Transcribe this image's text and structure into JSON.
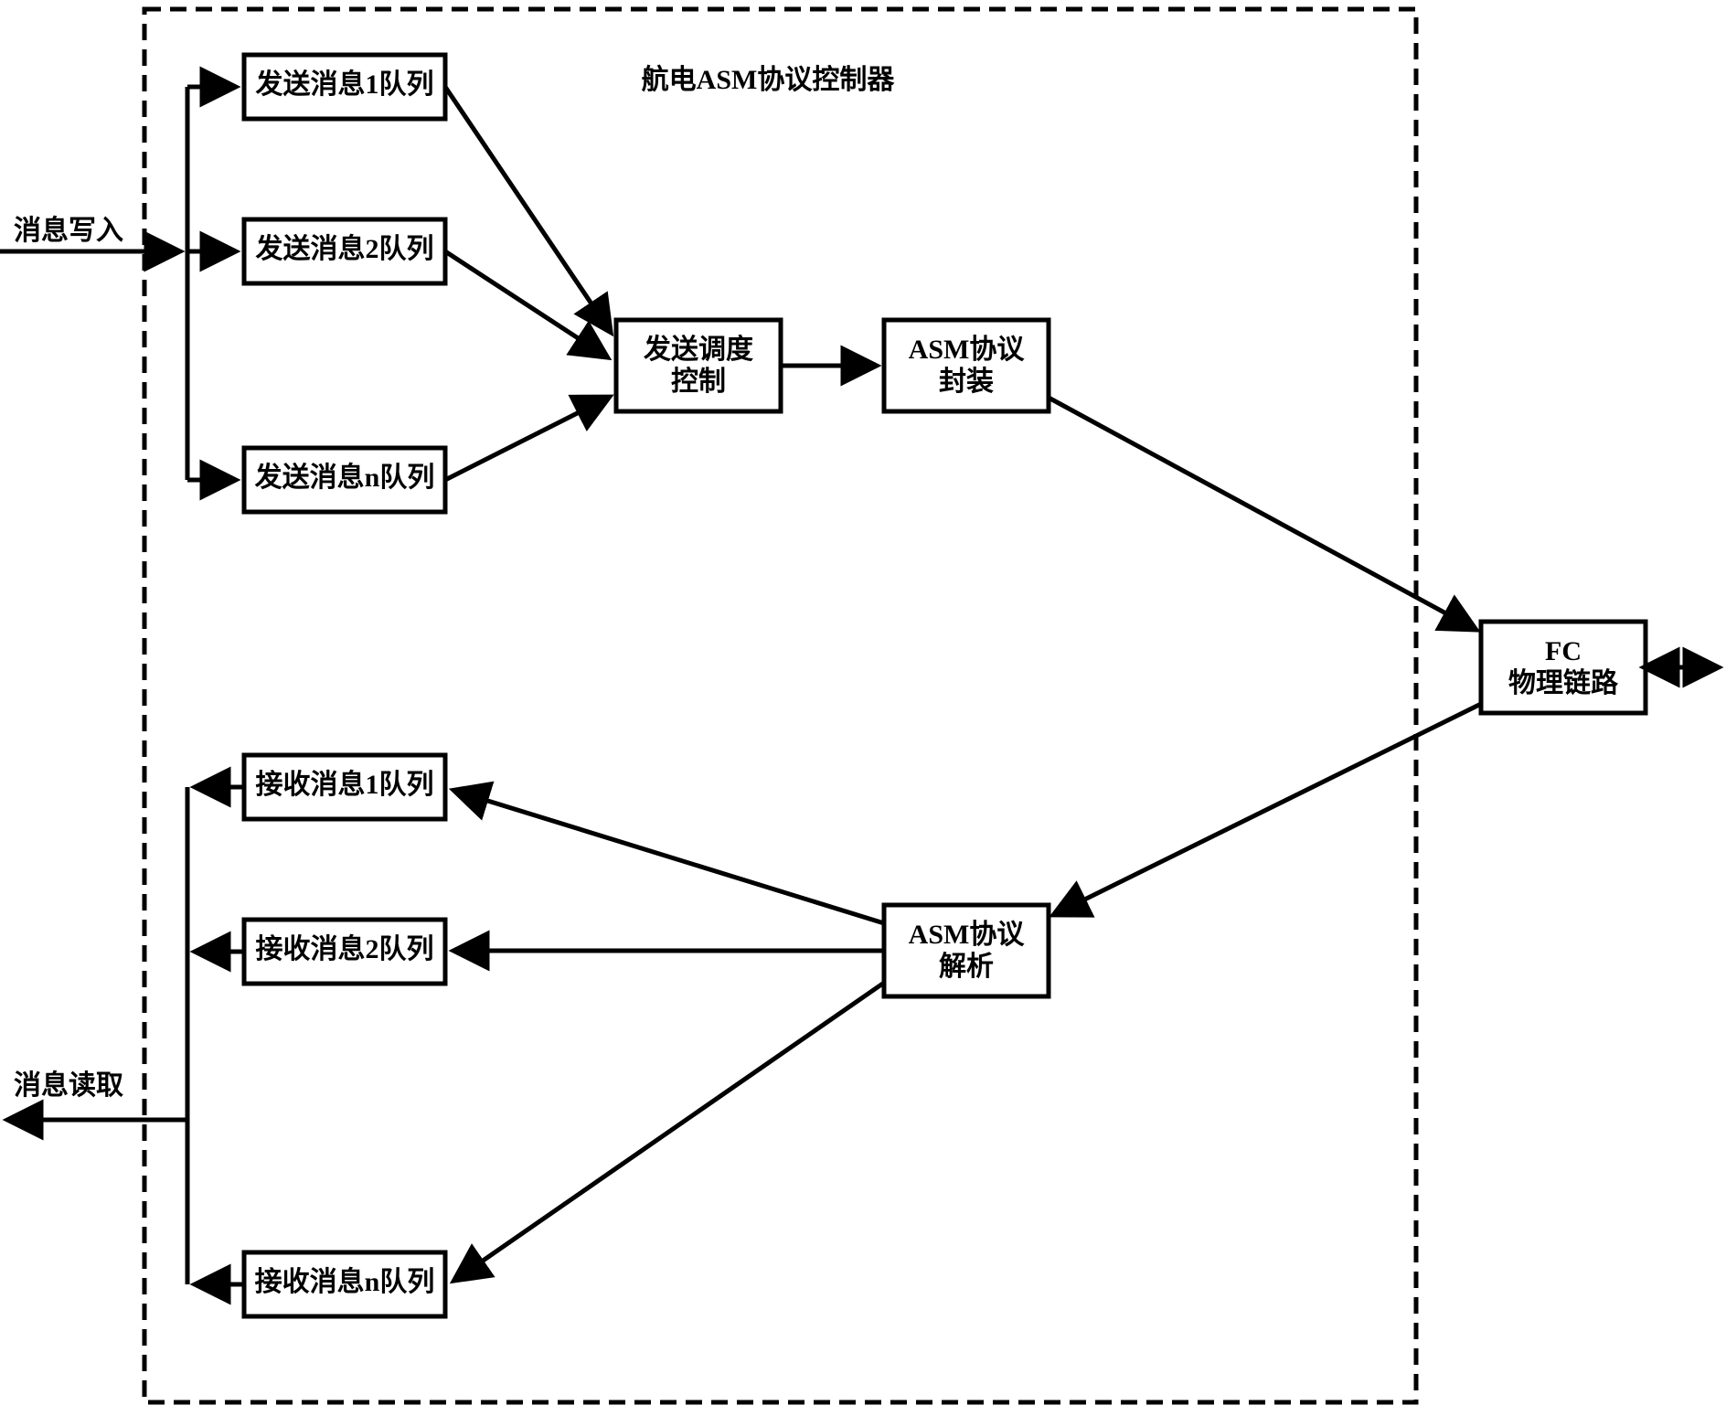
{
  "container_title": "航电ASM协议控制器",
  "external": {
    "msg_write": "消息写入",
    "msg_read": "消息读取"
  },
  "send": {
    "q1": "发送消息1队列",
    "q2": "发送消息2队列",
    "qn": "发送消息n队列",
    "sched_l1": "发送调度",
    "sched_l2": "控制",
    "encap_l1": "ASM协议",
    "encap_l2": "封装"
  },
  "recv": {
    "q1": "接收消息1队列",
    "q2": "接收消息2队列",
    "qn": "接收消息n队列",
    "parse_l1": "ASM协议",
    "parse_l2": "解析"
  },
  "phy": {
    "l1": "FC",
    "l2": "物理链路"
  }
}
